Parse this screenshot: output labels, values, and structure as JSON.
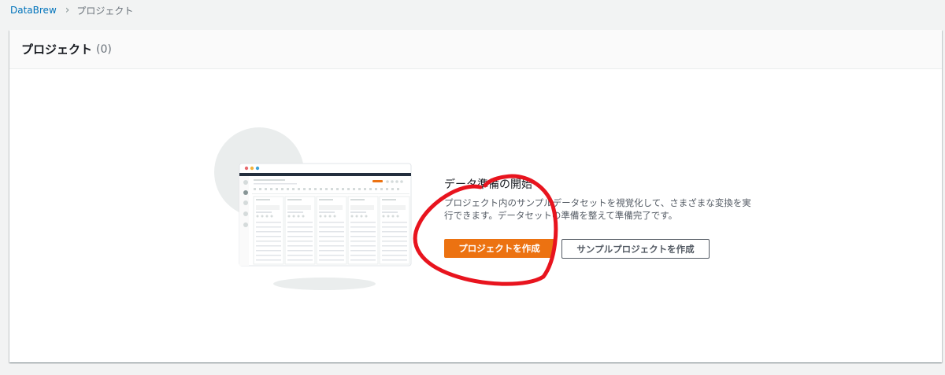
{
  "breadcrumb": {
    "root": "DataBrew",
    "current": "プロジェクト"
  },
  "panel": {
    "title": "プロジェクト",
    "count": "(0)"
  },
  "empty_state": {
    "title": "データ準備の開始",
    "description": "プロジェクト内のサンプルデータセットを視覚化して、さまざまな変換を実行できます。データセットの準備を整えて準備完了です。",
    "primary_button": "プロジェクトを作成",
    "secondary_button": "サンプルプロジェクトを作成"
  },
  "colors": {
    "primary": "#ec7211",
    "link": "#0073bb",
    "annotation": "#e8141e"
  }
}
